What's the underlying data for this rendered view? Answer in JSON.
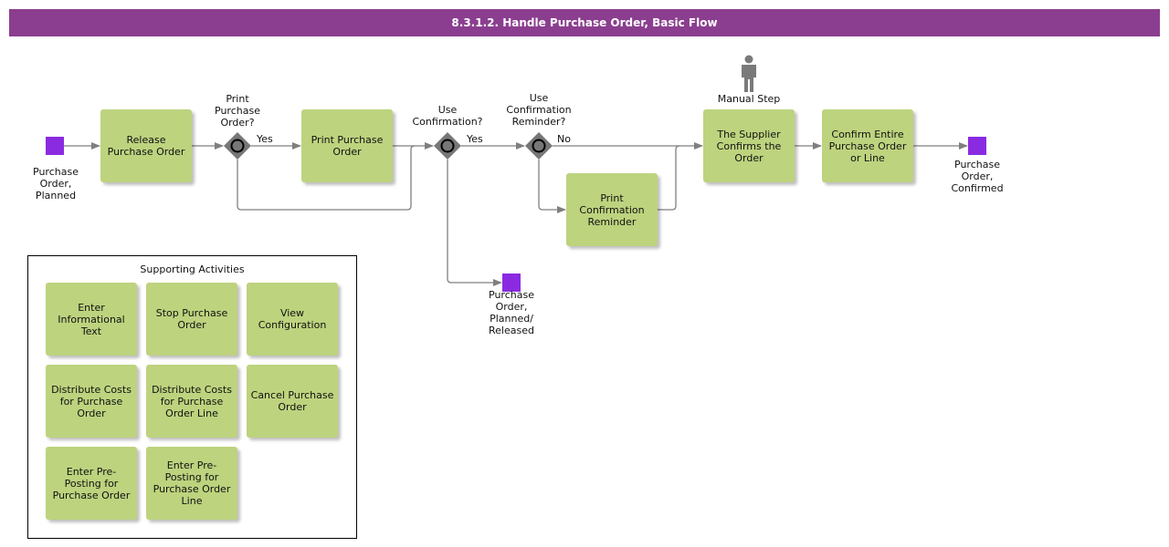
{
  "title": "8.3.1.2. Handle Purchase Order, Basic Flow",
  "colors": {
    "title_bar": "#8b3e8f",
    "event": "#8a2be2",
    "activity": "#bdd37e",
    "gateway": "#777777",
    "connector": "#7f7f7f"
  },
  "events": {
    "start": "Purchase\nOrder,\nPlanned",
    "end_confirmed": "Purchase\nOrder,\nConfirmed",
    "end_released": "Purchase\nOrder,\nPlanned/\nReleased"
  },
  "activities": {
    "release": "Release\nPurchase Order",
    "print_po": "Print Purchase\nOrder",
    "print_reminder": "Print\nConfirmation\nReminder",
    "supplier_confirms": "The Supplier\nConfirms the\nOrder",
    "confirm_entire": "Confirm Entire\nPurchase Order\nor Line"
  },
  "gateways": {
    "print_po": "Print\nPurchase\nOrder?",
    "use_confirmation": "Use\nConfirmation?",
    "use_reminder": "Use\nConfirmation\nReminder?"
  },
  "flow_labels": {
    "yes1": "Yes",
    "yes2": "Yes",
    "no": "No"
  },
  "manual_step": {
    "label": "Manual Step",
    "icon": "person-icon"
  },
  "supporting": {
    "title": "Supporting Activities",
    "items": [
      "Enter\nInformational\nText",
      "Stop Purchase\nOrder",
      "View\nConfiguration",
      "Distribute Costs\nfor Purchase\nOrder",
      "Distribute Costs\nfor Purchase\nOrder Line",
      "Cancel Purchase\nOrder",
      "Enter Pre-\nPosting for\nPurchase Order",
      "Enter Pre-\nPosting for\nPurchase Order\nLine"
    ]
  }
}
